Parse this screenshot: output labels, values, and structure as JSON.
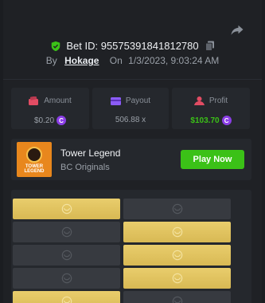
{
  "bet": {
    "id_label": "Bet ID: 95575391841812780",
    "by_label": "By",
    "user": "Hokage",
    "on_label": "On",
    "date": "1/3/2023, 9:03:24 AM"
  },
  "stats": [
    {
      "label": "Amount",
      "value": "$0.20",
      "coin": true,
      "icon": "wallet-icon"
    },
    {
      "label": "Payout",
      "value": "506.88 x",
      "coin": false,
      "icon": "card-icon"
    },
    {
      "label": "Profit",
      "value": "$103.70",
      "coin": true,
      "icon": "profit-icon"
    }
  ],
  "game": {
    "title": "Tower Legend",
    "provider": "BC Originals",
    "thumb_text": "TOWER LEGEND",
    "play_label": "Play Now"
  },
  "board": {
    "rows": [
      [
        "gold",
        "dark"
      ],
      [
        "dark",
        "gold"
      ],
      [
        "dark",
        "gold"
      ],
      [
        "dark",
        "gold"
      ],
      [
        "gold",
        "dark"
      ]
    ]
  },
  "colors": {
    "accent_green": "#3bc117",
    "coin_purple": "#8b3ee6",
    "tile_gold": "#e9cd6c",
    "tile_dark": "#373a40"
  }
}
